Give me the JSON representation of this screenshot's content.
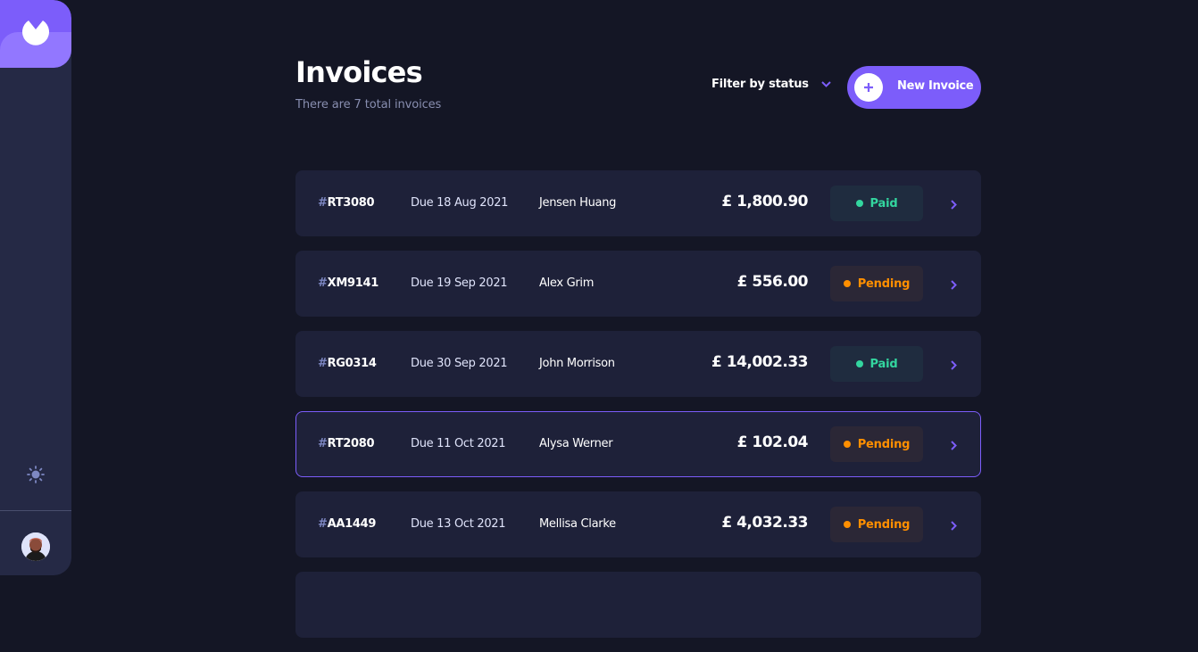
{
  "header": {
    "title": "Invoices",
    "subtitle": "There are 7 total invoices",
    "filter_label": "Filter by status",
    "new_button_label": "New Invoice"
  },
  "colors": {
    "accent": "#7c5dfa",
    "paid": "#33d69f",
    "pending": "#ff8f00",
    "background": "#141625",
    "card": "#1e2139"
  },
  "invoices": [
    {
      "hash": "#",
      "id": "RT3080",
      "due": "Due 18 Aug 2021",
      "client": "Jensen Huang",
      "amount": "£ 1,800.90",
      "status": "Paid"
    },
    {
      "hash": "#",
      "id": "XM9141",
      "due": "Due 19 Sep 2021",
      "client": "Alex Grim",
      "amount": "£ 556.00",
      "status": "Pending"
    },
    {
      "hash": "#",
      "id": "RG0314",
      "due": "Due 30 Sep 2021",
      "client": "John Morrison",
      "amount": "£ 14,002.33",
      "status": "Paid"
    },
    {
      "hash": "#",
      "id": "RT2080",
      "due": "Due 11 Oct 2021",
      "client": "Alysa Werner",
      "amount": "£ 102.04",
      "status": "Pending"
    },
    {
      "hash": "#",
      "id": "AA1449",
      "due": "Due 13 Oct 2021",
      "client": "Mellisa Clarke",
      "amount": "£ 4,032.33",
      "status": "Pending"
    }
  ]
}
